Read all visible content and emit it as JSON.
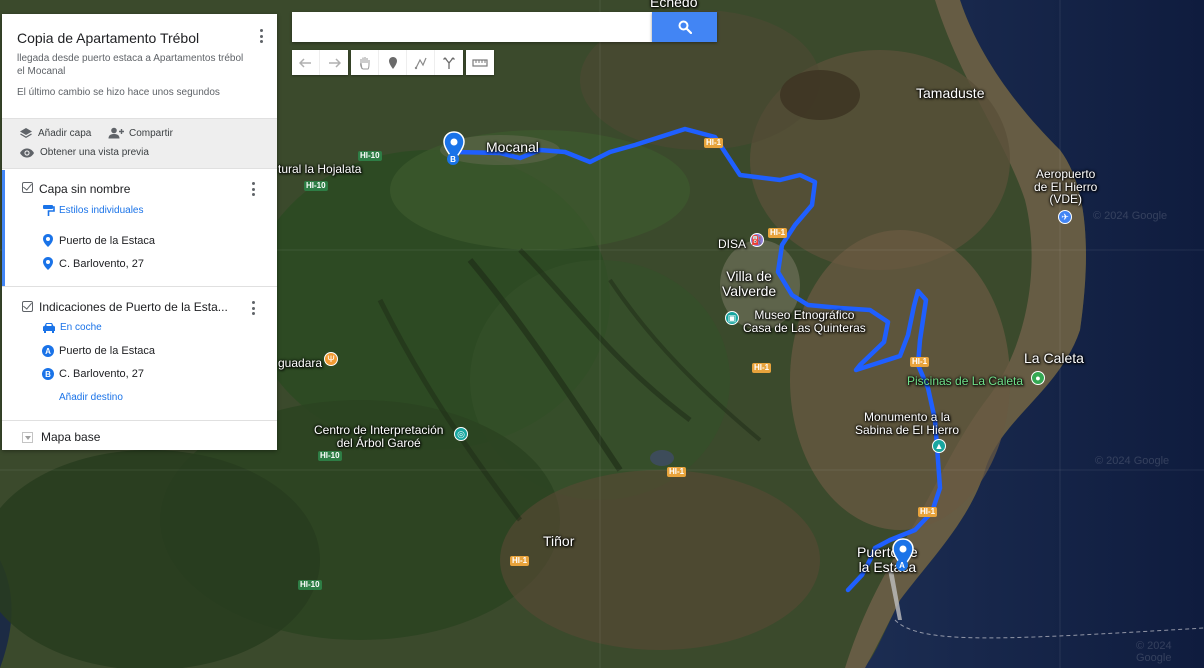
{
  "panel": {
    "title": "Copia de Apartamento Trébol",
    "description": "llegada desde puerto estaca a Apartamentos trébol el Mocanal",
    "last_change": "El último cambio se hizo hace unos segundos",
    "actions": {
      "add_layer": "Añadir capa",
      "share": "Compartir",
      "preview": "Obtener una vista previa"
    },
    "layers": [
      {
        "name": "Capa sin nombre",
        "style_link": "Estilos individuales",
        "items": [
          "Puerto de la Estaca",
          "C. Barlovento, 27"
        ]
      },
      {
        "name": "Indicaciones de Puerto de la Esta...",
        "mode": "En coche",
        "items": [
          {
            "badge": "A",
            "label": "Puerto de la Estaca"
          },
          {
            "badge": "B",
            "label": "C. Barlovento, 27"
          }
        ],
        "add_destination": "Añadir destino"
      }
    ],
    "base_map": "Mapa base"
  },
  "search": {
    "value": "",
    "placeholder": ""
  },
  "toolbar": {
    "icons": [
      "undo-icon",
      "redo-icon",
      "hand-icon",
      "marker-icon",
      "draw-line-icon",
      "route-icon",
      "ruler-icon"
    ]
  },
  "map": {
    "places": {
      "echedo": "Echedo",
      "mocanal": "Mocanal",
      "tamaduste": "Tamaduste",
      "hojalata": "tural la Hojalata",
      "aeropuerto": "Aeropuerto\nde El Hierro\n(VDE)",
      "disa": "DISA",
      "valverde": "Villa de\nValverde",
      "museo": "Museo Etnográfico\nCasa de Las Quinteras",
      "lacaleta": "La Caleta",
      "piscinas": "Piscinas de La Caleta",
      "aguadara": "guadara",
      "monumento": "Monumento a la\nSabina de El Hierro",
      "centro": "Centro de Interpretación\ndel Árbol Garoé",
      "tinor": "Tiñor",
      "puerto": "Puerto de\nla Estaca"
    },
    "roads": {
      "hi10": "HI-10",
      "hi1": "HI-1"
    },
    "watermark": "© 2024 Google",
    "route_color": "#1f5fff",
    "marker_a": "A",
    "marker_b": "B"
  }
}
